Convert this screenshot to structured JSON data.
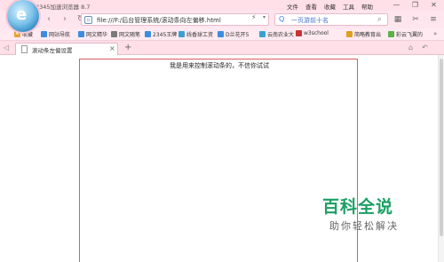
{
  "window": {
    "title": "2345加速浏览器 8.7",
    "menu": [
      "文件",
      "查看",
      "收藏",
      "工具",
      "帮助"
    ],
    "controls": [
      "—",
      "❐",
      "✕"
    ]
  },
  "address_bar": {
    "url": "file:///F:/后台管理系统/滚动条向左偏移.html",
    "lightning_icon": "⚡",
    "dropdown_icon": "▾",
    "search_text": "一页游前十名",
    "search_engine_icon": "Q"
  },
  "bookmarks": [
    {
      "label": "收藏",
      "color": "#e7a13a"
    },
    {
      "label": "网站导航",
      "color": "#3c8de0"
    },
    {
      "label": "网文精华",
      "color": "#3c8de0"
    },
    {
      "label": "网文随笔",
      "color": "#7a7a7a"
    },
    {
      "label": "2345王牌",
      "color": "#3c8de0"
    },
    {
      "label": "线香球工资",
      "color": "#3aa0d0"
    },
    {
      "label": "D兰花开5",
      "color": "#3c8de0"
    },
    {
      "label": "云南农业大",
      "color": "#3aa0d0"
    },
    {
      "label": "w3school",
      "color": "#c83232"
    },
    {
      "label": "简略教育出",
      "color": "#e0a020"
    },
    {
      "label": "彩云飞翼的",
      "color": "#5ab04a"
    }
  ],
  "tab": {
    "title": "滚动条左偏设置",
    "close": "×",
    "new_tab": "+"
  },
  "page": {
    "box_text": "我是用来控制滚动条的，不信你试试"
  },
  "watermark": {
    "main": "百科全说",
    "sub": "助你轻松解决"
  }
}
